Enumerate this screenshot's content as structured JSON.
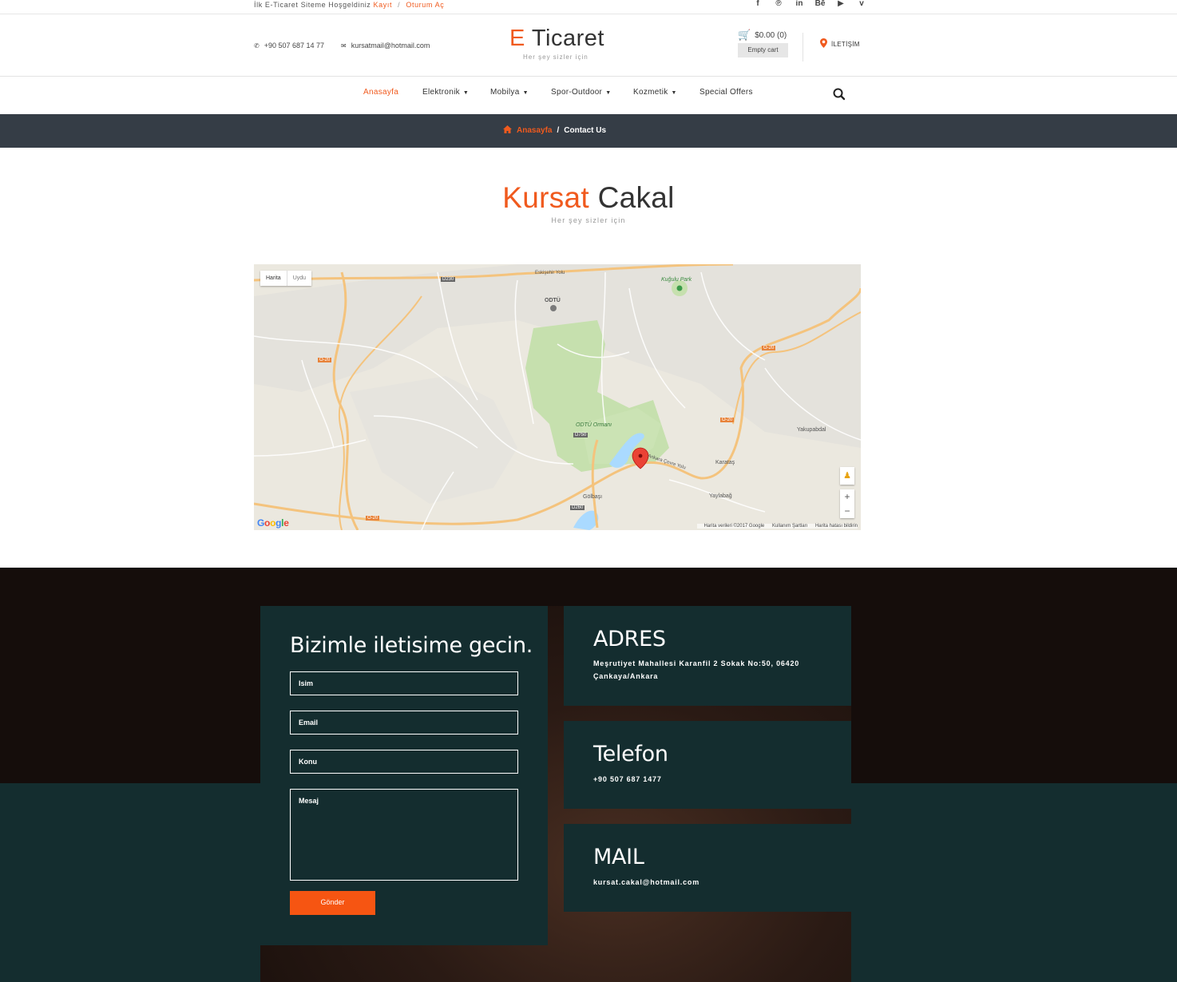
{
  "topbar": {
    "welcome": "İlk E-Ticaret Siteme Hoşgeldiniz",
    "register": "Kayıt",
    "separator": "/",
    "login": "Oturum Aç",
    "socials": [
      "f",
      "℗",
      "in",
      "Bē",
      "▶",
      "v"
    ]
  },
  "header": {
    "phone": "+90 507 687 14 77",
    "email": "kursatmail@hotmail.com",
    "brand_first": "E",
    "brand_rest": " Ticaret",
    "tagline": "Her şey sizler için",
    "cart_total": "$0.00 (0)",
    "cart_empty": "Empty cart",
    "contact": "İLETİŞİM"
  },
  "nav": {
    "items": [
      "Anasayfa",
      "Elektronik",
      "Mobilya",
      "Spor-Outdoor",
      "Kozmetik",
      "Special Offers"
    ],
    "caret": "▼"
  },
  "breadcrumb": {
    "home": "Anasayfa",
    "separator": "/",
    "current": "Contact Us"
  },
  "page": {
    "title_first": "Kursat",
    "title_rest": " Cakal",
    "subtitle": "Her şey sizler için"
  },
  "map": {
    "type_map": "Harita",
    "type_satellite": "Uydu",
    "zoom_in": "+",
    "zoom_out": "−",
    "attribution": [
      "Harita verileri ©2017 Google",
      "Kullanım Şartları",
      "Harita hatası bildirin"
    ],
    "labels": [
      "ODTÜ",
      "Kuğulu Park",
      "ODTÜ Ormanı",
      "Yakupabdal",
      "Karataş",
      "Yaylabağ",
      "Gölbaşı",
      "Eskişehir Yolu",
      "Ankara Çevre Yolu",
      "D750",
      "D260",
      "D230",
      "O-20"
    ],
    "google": [
      "G",
      "o",
      "o",
      "g",
      "l",
      "e"
    ]
  },
  "contact_form": {
    "heading": "Bizimle iletisime gecin.",
    "name_placeholder": "Isim",
    "email_placeholder": "Email",
    "subject_placeholder": "Konu",
    "message_placeholder": "Mesaj",
    "submit": "Gönder"
  },
  "info": {
    "address_title": "ADRES",
    "address_value": "Meşrutiyet Mahallesi Karanfil 2 Sokak No:50, 06420 Çankaya/Ankara",
    "phone_title": "Telefon",
    "phone_value": "+90 507 687 1477",
    "mail_title": "MAIL",
    "mail_value": "kursat.cakal@hotmail.com"
  },
  "colors": {
    "accent": "#f05a1e",
    "breadcrumb_bg": "#353d46",
    "panel_bg": "#142d2f",
    "button": "#f65512"
  }
}
